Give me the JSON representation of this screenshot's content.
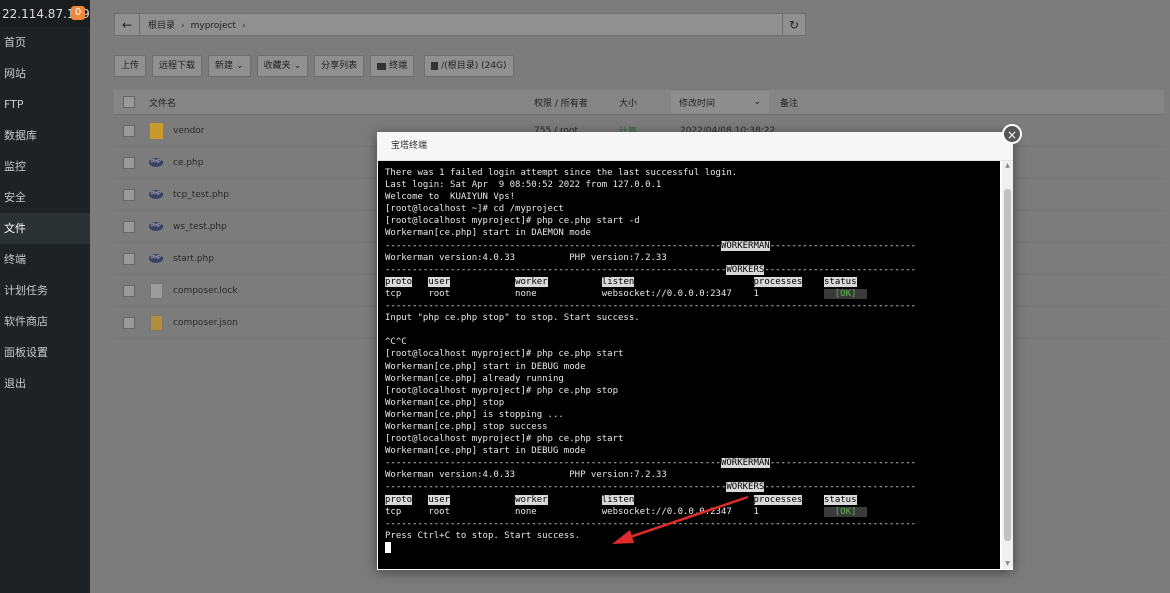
{
  "sidebar": {
    "ip": "22.114.87.169",
    "badge": "0",
    "items": [
      {
        "label": "首页"
      },
      {
        "label": "网站"
      },
      {
        "label": "FTP"
      },
      {
        "label": "数据库"
      },
      {
        "label": "监控"
      },
      {
        "label": "安全"
      },
      {
        "label": "文件",
        "active": true
      },
      {
        "label": "终端"
      },
      {
        "label": "计划任务"
      },
      {
        "label": "软件商店"
      },
      {
        "label": "面板设置"
      },
      {
        "label": "退出"
      }
    ]
  },
  "pathbar": {
    "root": "根目录",
    "folder": "myproject"
  },
  "toolbar": {
    "upload": "上传",
    "remote_download": "远程下载",
    "new": "新建",
    "favorites": "收藏夹",
    "share_list": "分享列表",
    "terminal": "终端",
    "disk": "/(根目录) (24G)"
  },
  "table": {
    "headers": {
      "name": "文件名",
      "perm": "权限 / 所有者",
      "size": "大小",
      "time": "修改时间",
      "note": "备注"
    },
    "rows": [
      {
        "name": "vendor",
        "icon": "folder",
        "perm": "755 / root",
        "size": "计算",
        "time": "2022/04/08 10:38:22"
      },
      {
        "name": "ce.php",
        "icon": "php"
      },
      {
        "name": "tcp_test.php",
        "icon": "php"
      },
      {
        "name": "ws_test.php",
        "icon": "php"
      },
      {
        "name": "start.php",
        "icon": "php"
      },
      {
        "name": "composer.lock",
        "icon": "doc"
      },
      {
        "name": "composer.json",
        "icon": "json"
      }
    ]
  },
  "modal": {
    "title": "宝塔终端",
    "close": "×"
  },
  "terminal": {
    "lines": [
      "There was 1 failed login attempt since the last successful login.",
      "Last login: Sat Apr  9 08:50:52 2022 from 127.0.0.1",
      "Welcome to  KUAIYUN Vps!",
      "[root@localhost ~]# cd /myproject",
      "[root@localhost myproject]# php ce.php start -d",
      "Workerman[ce.php] start in DAEMON mode"
    ],
    "workerman_label": "WORKERMAN",
    "workers_label": "WORKERS",
    "version_line": "Workerman version:4.0.33          PHP version:7.2.33",
    "cols": [
      "proto",
      "user",
      "worker",
      "listen",
      "processes",
      "status"
    ],
    "row_vals": [
      "tcp",
      "root",
      "none",
      "websocket://0.0.0.0:2347",
      "1",
      "[OK]"
    ],
    "stop_hint": "Input \"php ce.php stop\" to stop. Start success.",
    "lines2": [
      "^C^C",
      "[root@localhost myproject]# php ce.php start",
      "Workerman[ce.php] start in DEBUG mode",
      "Workerman[ce.php] already running",
      "[root@localhost myproject]# php ce.php stop",
      "Workerman[ce.php] stop",
      "Workerman[ce.php] is stopping ...",
      "Workerman[ce.php] stop success",
      "[root@localhost myproject]# php ce.php start",
      "Workerman[ce.php] start in DEBUG mode"
    ],
    "final_hint": "Press Ctrl+C to stop. Start success."
  },
  "colors": {
    "annotation_arrow": "#e02b2b",
    "sidebar_bg": "#1f2224",
    "terminal_bg": "#000000",
    "ok_green": "#5fba4d"
  }
}
